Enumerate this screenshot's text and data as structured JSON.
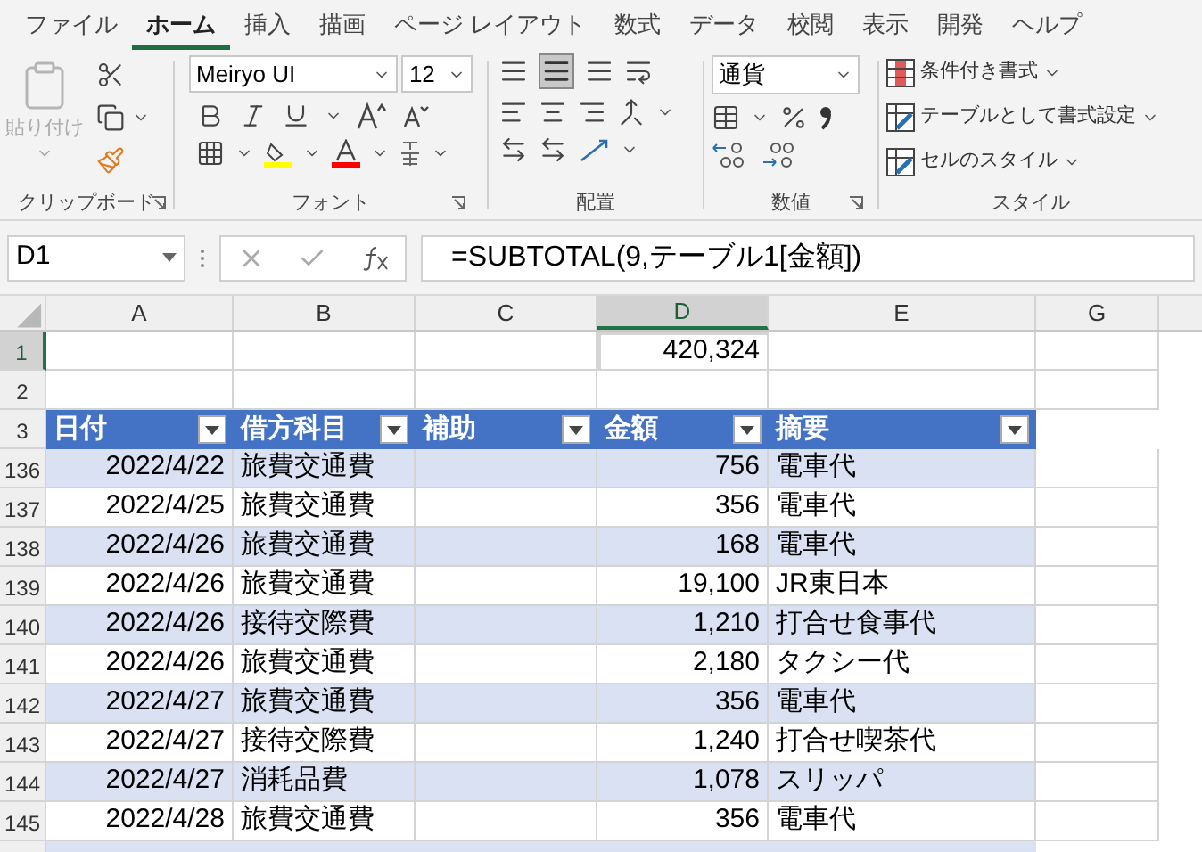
{
  "tabs": [
    {
      "label": "ファイル",
      "selected": false
    },
    {
      "label": "ホーム",
      "selected": true
    },
    {
      "label": "挿入",
      "selected": false
    },
    {
      "label": "描画",
      "selected": false
    },
    {
      "label": "ページ レイアウト",
      "selected": false
    },
    {
      "label": "数式",
      "selected": false
    },
    {
      "label": "データ",
      "selected": false
    },
    {
      "label": "校閲",
      "selected": false
    },
    {
      "label": "表示",
      "selected": false
    },
    {
      "label": "開発",
      "selected": false
    },
    {
      "label": "ヘルプ",
      "selected": false
    }
  ],
  "ribbon": {
    "clipboard": {
      "paste_label": "貼り付け",
      "group_label": "クリップボード"
    },
    "font": {
      "font_name": "Meiryo UI",
      "font_size": "12",
      "group_label": "フォント"
    },
    "alignment": {
      "group_label": "配置"
    },
    "number": {
      "format": "通貨",
      "group_label": "数値"
    },
    "styles": {
      "buttons": [
        "条件付き書式",
        "テーブルとして書式設定",
        "セルのスタイル"
      ],
      "group_label": "スタイル"
    }
  },
  "formula_bar": {
    "name_box": "D1",
    "formula": "=SUBTOTAL(9,テーブル1[金額])"
  },
  "sheet": {
    "columns": [
      {
        "label": "A",
        "selected": false
      },
      {
        "label": "B",
        "selected": false
      },
      {
        "label": "C",
        "selected": false
      },
      {
        "label": "D",
        "selected": true
      },
      {
        "label": "E",
        "selected": false
      },
      {
        "label": "G",
        "selected": false
      }
    ],
    "total_row": {
      "row": "1",
      "value": "420,324"
    },
    "empty_row": "2",
    "header_row": "3",
    "table_headers": [
      "日付",
      "借方科目",
      "補助",
      "金額",
      "摘要"
    ],
    "rows": [
      {
        "row": "136",
        "date": "2022/4/22",
        "account": "旅費交通費",
        "amount": "756",
        "memo": "電車代"
      },
      {
        "row": "137",
        "date": "2022/4/25",
        "account": "旅費交通費",
        "amount": "356",
        "memo": "電車代"
      },
      {
        "row": "138",
        "date": "2022/4/26",
        "account": "旅費交通費",
        "amount": "168",
        "memo": "電車代"
      },
      {
        "row": "139",
        "date": "2022/4/26",
        "account": "旅費交通費",
        "amount": "19,100",
        "memo": "JR東日本"
      },
      {
        "row": "140",
        "date": "2022/4/26",
        "account": "接待交際費",
        "amount": "1,210",
        "memo": "打合せ食事代"
      },
      {
        "row": "141",
        "date": "2022/4/26",
        "account": "旅費交通費",
        "amount": "2,180",
        "memo": "タクシー代"
      },
      {
        "row": "142",
        "date": "2022/4/27",
        "account": "旅費交通費",
        "amount": "356",
        "memo": "電車代"
      },
      {
        "row": "143",
        "date": "2022/4/27",
        "account": "接待交際費",
        "amount": "1,240",
        "memo": "打合せ喫茶代"
      },
      {
        "row": "144",
        "date": "2022/4/27",
        "account": "消耗品費",
        "amount": "1,078",
        "memo": "スリッパ"
      },
      {
        "row": "145",
        "date": "2022/4/28",
        "account": "旅費交通費",
        "amount": "356",
        "memo": "電車代"
      }
    ]
  }
}
